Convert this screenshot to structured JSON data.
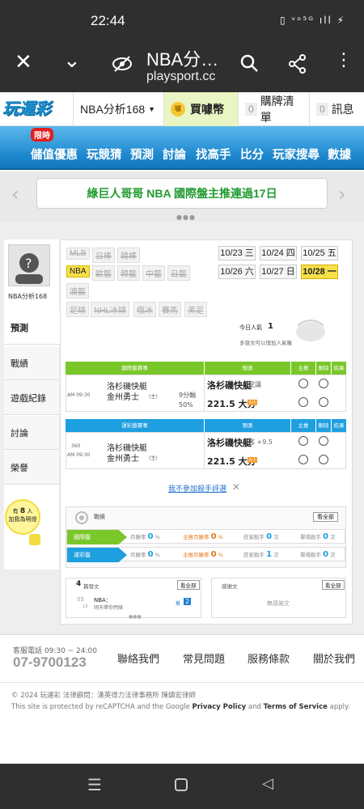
{
  "status": {
    "time": "22:44",
    "icons": "▯ ᵛᵒ⁵ᴳ ıll ⚡"
  },
  "browser": {
    "title": "NBA分…",
    "url": "playsport.cc"
  },
  "header": {
    "logo": "玩運彩",
    "menu_label": "NBA分析168",
    "buy_label": "買噱幣",
    "cart_count": "0",
    "cart_label": "購牌清單",
    "msg_count": "0",
    "msg_label": "訊息"
  },
  "nav": {
    "limit_badge": "限時",
    "items": [
      "儲值優惠",
      "玩競猜",
      "預測",
      "討論",
      "找高手",
      "比分",
      "玩家搜尋",
      "數據"
    ]
  },
  "banner": {
    "text": "綠巨人哥哥 NBA 國際盤主推連過17日"
  },
  "sidebar": {
    "avatar_label": "NBA分析168",
    "tabs": [
      "預測",
      "戰績",
      "遊戲紀錄",
      "討論",
      "榮譽"
    ],
    "bulb_line1": "有",
    "bulb_count": "8",
    "bulb_line1b": "人",
    "bulb_line2": "加我為明燈"
  },
  "sports": {
    "row1": [
      "MLB",
      "日棒",
      "韓棒"
    ],
    "row2": [
      "NBA",
      "歐籃",
      "韓籃",
      "中籃",
      "日籃"
    ],
    "row3": [
      "澳籃"
    ],
    "row4": [
      "足球",
      "NHL冰球",
      "俄冰",
      "賽馬",
      "美足"
    ]
  },
  "dates": [
    {
      "d": "10/23",
      "w": "三"
    },
    {
      "d": "10/24",
      "w": "四"
    },
    {
      "d": "10/25",
      "w": "五"
    },
    {
      "d": "10/26",
      "w": "六"
    },
    {
      "d": "10/27",
      "w": "日"
    },
    {
      "d": "10/28",
      "w": "一"
    }
  ],
  "popularity": {
    "label": "今日人氣",
    "value": "1",
    "hint": "多發文可以增加人氣喔"
  },
  "intl": {
    "head": "國際盤賽事",
    "pick_head": "預測",
    "main_head": "主推",
    "del_head": "刪除",
    "result_head": "結果",
    "time": "AM 09:30",
    "team1": "洛杉磯快艇",
    "team2": "金州勇士",
    "team2_mark": "(主)",
    "odds_note": "9分輸",
    "pct": "50%",
    "pick1": "洛杉磯快艇",
    "pick1_note": "受讓",
    "pick2": "221.5 大分",
    "pick2_badge": "大小"
  },
  "lottery": {
    "head": "運彩盤賽事",
    "pick_head": "預測",
    "main_head": "主推",
    "del_head": "刪除",
    "result_head": "結果",
    "num": "360",
    "time": "AM 09:30",
    "team1": "洛杉磯快艇",
    "team2": "金州勇士",
    "team2_mark": "(主)",
    "pick1": "洛杉磯快艇",
    "pick1_note": "客 +9.5",
    "pick2": "221.5 大分",
    "pick2_badge": "大小"
  },
  "skip_link": "我不參加殺手評選",
  "record": {
    "title": "戰績",
    "view_all": "看全部",
    "rows": [
      {
        "tag": "國際盤",
        "color": "#7ac72a",
        "a": "月勝率",
        "av": "0",
        "au": "%",
        "b": "主推月勝率",
        "bv": "0",
        "bu": "%",
        "c": "莊家殺手",
        "cv": "0",
        "cu": "次",
        "d": "單場殺手",
        "dv": "0",
        "du": "次"
      },
      {
        "tag": "運彩盤",
        "color": "#1e9fe0",
        "a": "月勝率",
        "av": "0",
        "au": "%",
        "b": "主推月勝率",
        "bv": "0",
        "bu": "%",
        "c": "莊家殺手",
        "cv": "1",
        "cu": "次",
        "d": "單場殺手",
        "dv": "0",
        "du": "次"
      }
    ]
  },
  "articles": {
    "count": "4",
    "title": "篇發文",
    "view_all": "看全部",
    "item_date": "05",
    "item_month": "13",
    "item_title": "NBA：",
    "item_sub": "明天帶你們綠",
    "item_tag": "推",
    "item_num": "2",
    "thanks_title": "感謝文",
    "thanks_all": "看全部",
    "thanks_empty": "無感謝文"
  },
  "footer": {
    "service": "客服電話 09:30 ~ 24:00",
    "phone": "07-9700123",
    "links": [
      "聯絡我們",
      "常見問題",
      "服務條款",
      "關於我們"
    ],
    "copyright": "© 2024 玩運彩 法律顧問：漢英得力法律事務所 陳鎮宏律師",
    "recaptcha_a": "This site is protected by reCAPTCHA and the Google ",
    "privacy": "Privacy Policy",
    "and": " and ",
    "terms": "Terms of Service",
    "apply": " apply."
  },
  "colors": {
    "nav_blue": "#1e88cf",
    "intl_green": "#7ac72a",
    "lottery_blue": "#1e9fe0",
    "highlight": "#f6e04a"
  }
}
